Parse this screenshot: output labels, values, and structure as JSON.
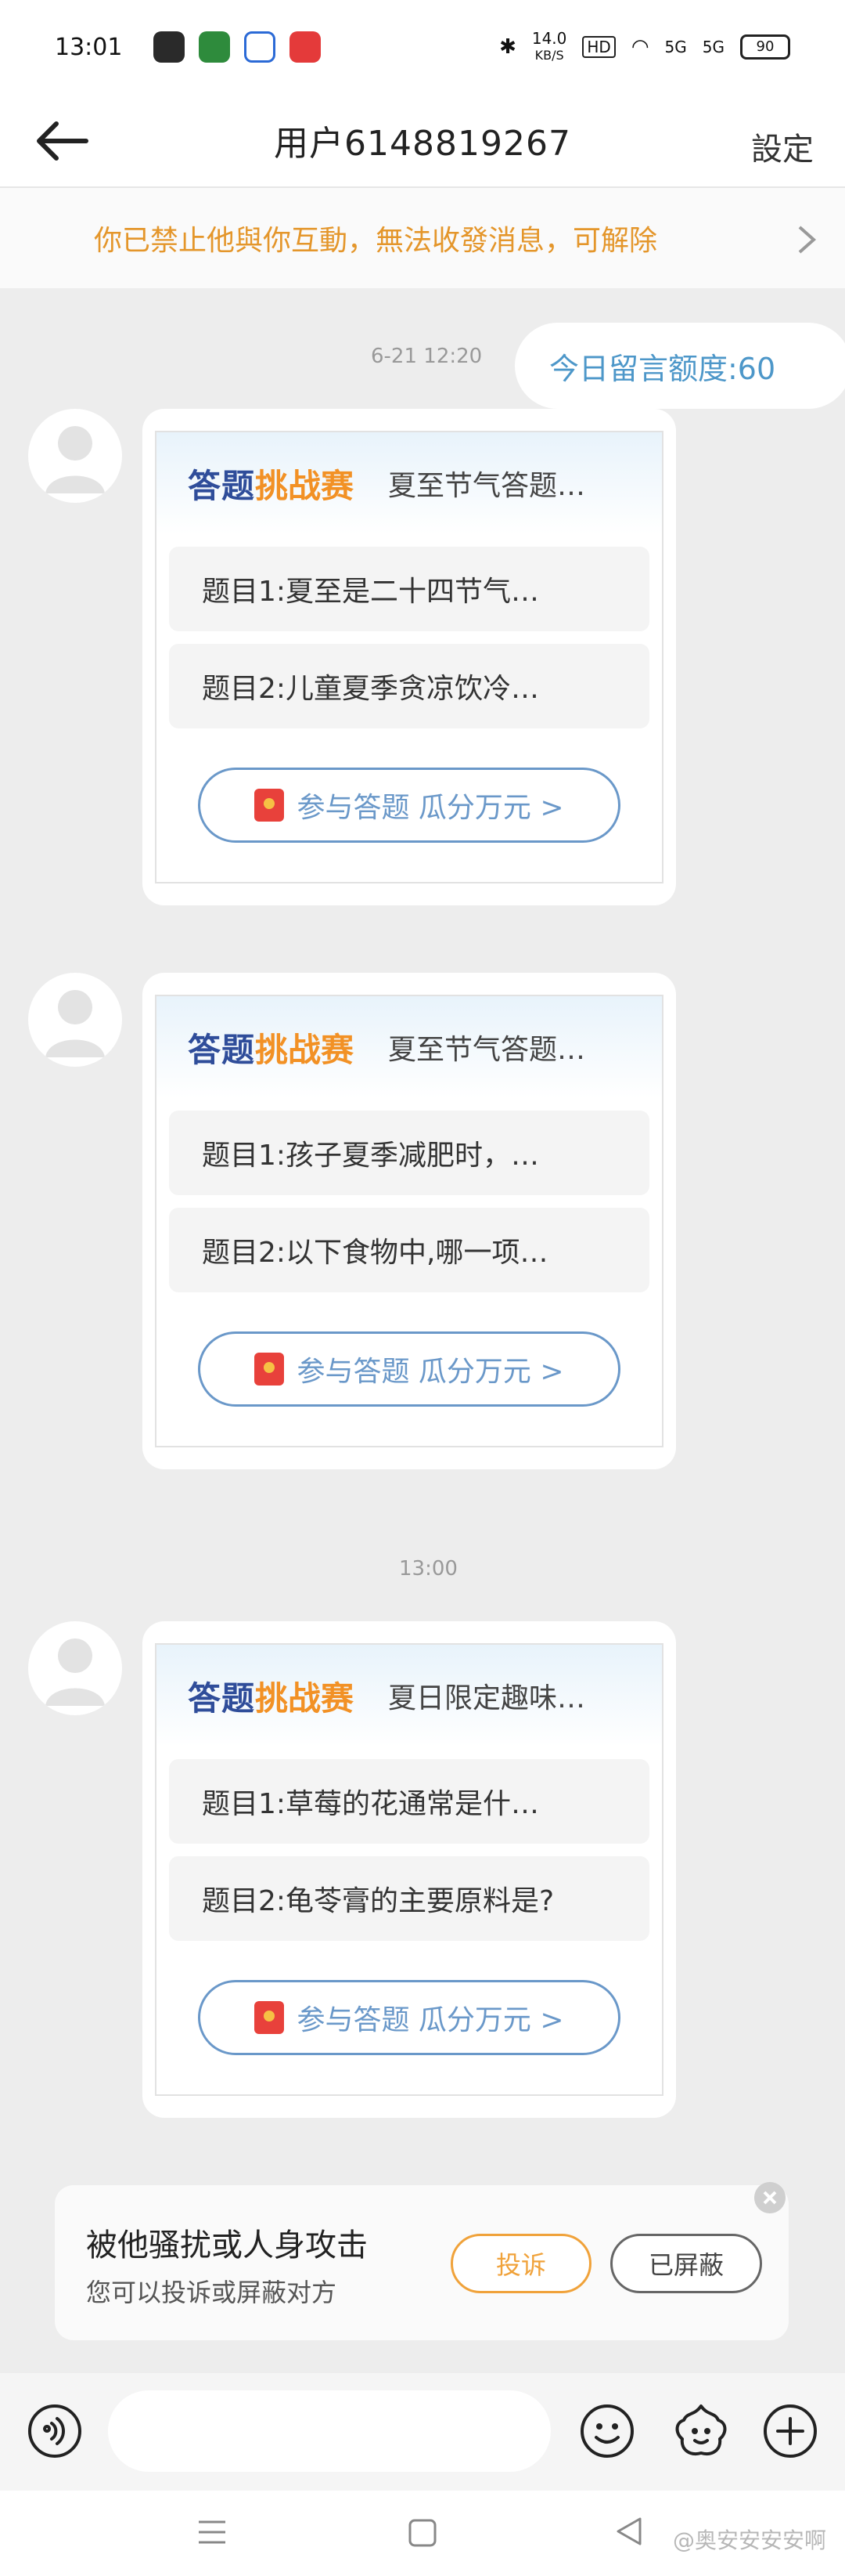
{
  "status_bar": {
    "time": "13:01",
    "network_speed": "14.0",
    "network_unit": "KB/S",
    "hd_label": "HD",
    "signal_1": "5G",
    "signal_2": "5G",
    "battery": "90"
  },
  "header": {
    "title": "用户6148819267",
    "settings_label": "設定"
  },
  "notice": {
    "text": "你已禁止他與你互動，無法收發消息，可解除"
  },
  "quota": {
    "text": "今日留言额度:60"
  },
  "timestamps": {
    "first": "6-21 12:20",
    "second": "13:00"
  },
  "cards": [
    {
      "brand_a": "答题",
      "brand_b": "挑战赛",
      "subtitle": "夏至节气答题…",
      "q1": "题目1:夏至是二十四节气…",
      "q2": "题目2:儿童夏季贪凉饮冷…",
      "button": "参与答题 瓜分万元 >"
    },
    {
      "brand_a": "答题",
      "brand_b": "挑战赛",
      "subtitle": "夏至节气答题…",
      "q1": "题目1:孩子夏季减肥时，…",
      "q2": "题目2:以下食物中,哪一项…",
      "button": "参与答题 瓜分万元 >"
    },
    {
      "brand_a": "答题",
      "brand_b": "挑战赛",
      "subtitle": "夏日限定趣味…",
      "q1": "题目1:草莓的花通常是什…",
      "q2": "题目2:龟苓膏的主要原料是?",
      "button": "参与答题 瓜分万元 >"
    }
  ],
  "harassment": {
    "title": "被他骚扰或人身攻击",
    "subtitle": "您可以投诉或屏蔽对方",
    "report_label": "投诉",
    "blocked_label": "已屏蔽"
  },
  "watermark": "@奥安安安安啊",
  "colors": {
    "accent_blue": "#4d97c9",
    "notice_orange": "#e4962b",
    "brand_navy": "#2f4d9a",
    "brand_orange": "#f29125"
  },
  "icons": [
    "back-arrow-icon",
    "chevron-right-icon",
    "avatar-icon",
    "red-packet-icon",
    "voice-icon",
    "emoji-icon",
    "sticker-icon",
    "plus-icon",
    "close-icon"
  ]
}
